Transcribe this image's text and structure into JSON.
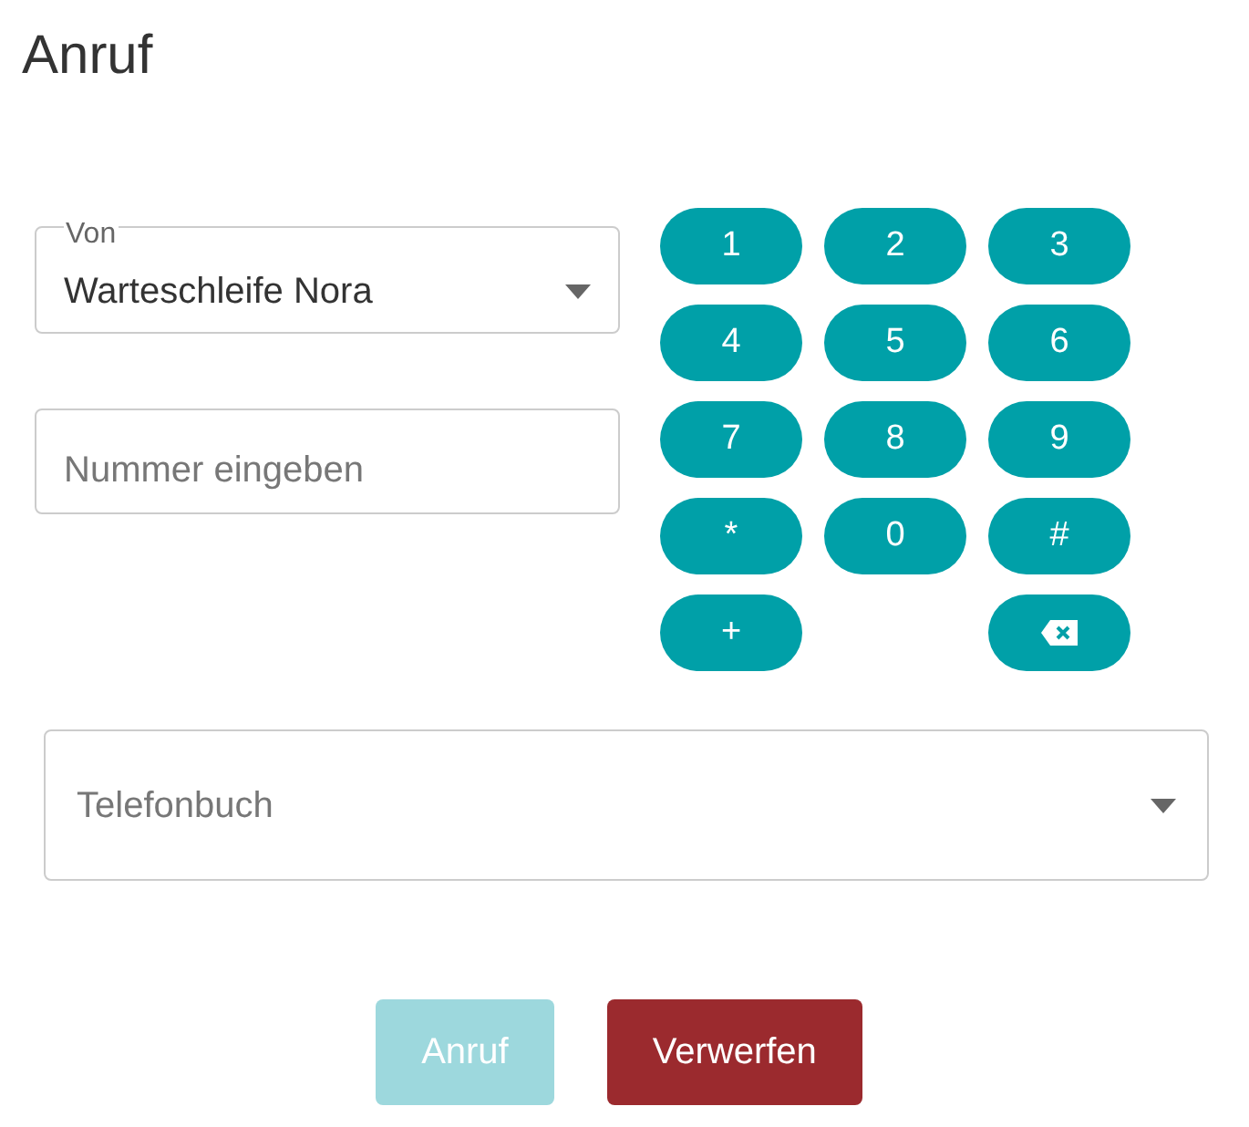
{
  "title": "Anruf",
  "from": {
    "label": "Von",
    "value": "Warteschleife Nora"
  },
  "number": {
    "placeholder": "Nummer eingeben"
  },
  "keypad": [
    {
      "kind": "key",
      "label": "1"
    },
    {
      "kind": "key",
      "label": "2"
    },
    {
      "kind": "key",
      "label": "3"
    },
    {
      "kind": "key",
      "label": "4"
    },
    {
      "kind": "key",
      "label": "5"
    },
    {
      "kind": "key",
      "label": "6"
    },
    {
      "kind": "key",
      "label": "7"
    },
    {
      "kind": "key",
      "label": "8"
    },
    {
      "kind": "key",
      "label": "9"
    },
    {
      "kind": "key",
      "label": "*"
    },
    {
      "kind": "key",
      "label": "0"
    },
    {
      "kind": "key",
      "label": "#"
    },
    {
      "kind": "key",
      "label": "+"
    },
    {
      "kind": "empty"
    },
    {
      "kind": "backspace"
    }
  ],
  "phonebook": {
    "placeholder": "Telefonbuch"
  },
  "buttons": [
    {
      "label": "Anruf",
      "kind": "primary",
      "disabled": true
    },
    {
      "label": "Verwerfen",
      "kind": "danger",
      "disabled": false
    }
  ]
}
